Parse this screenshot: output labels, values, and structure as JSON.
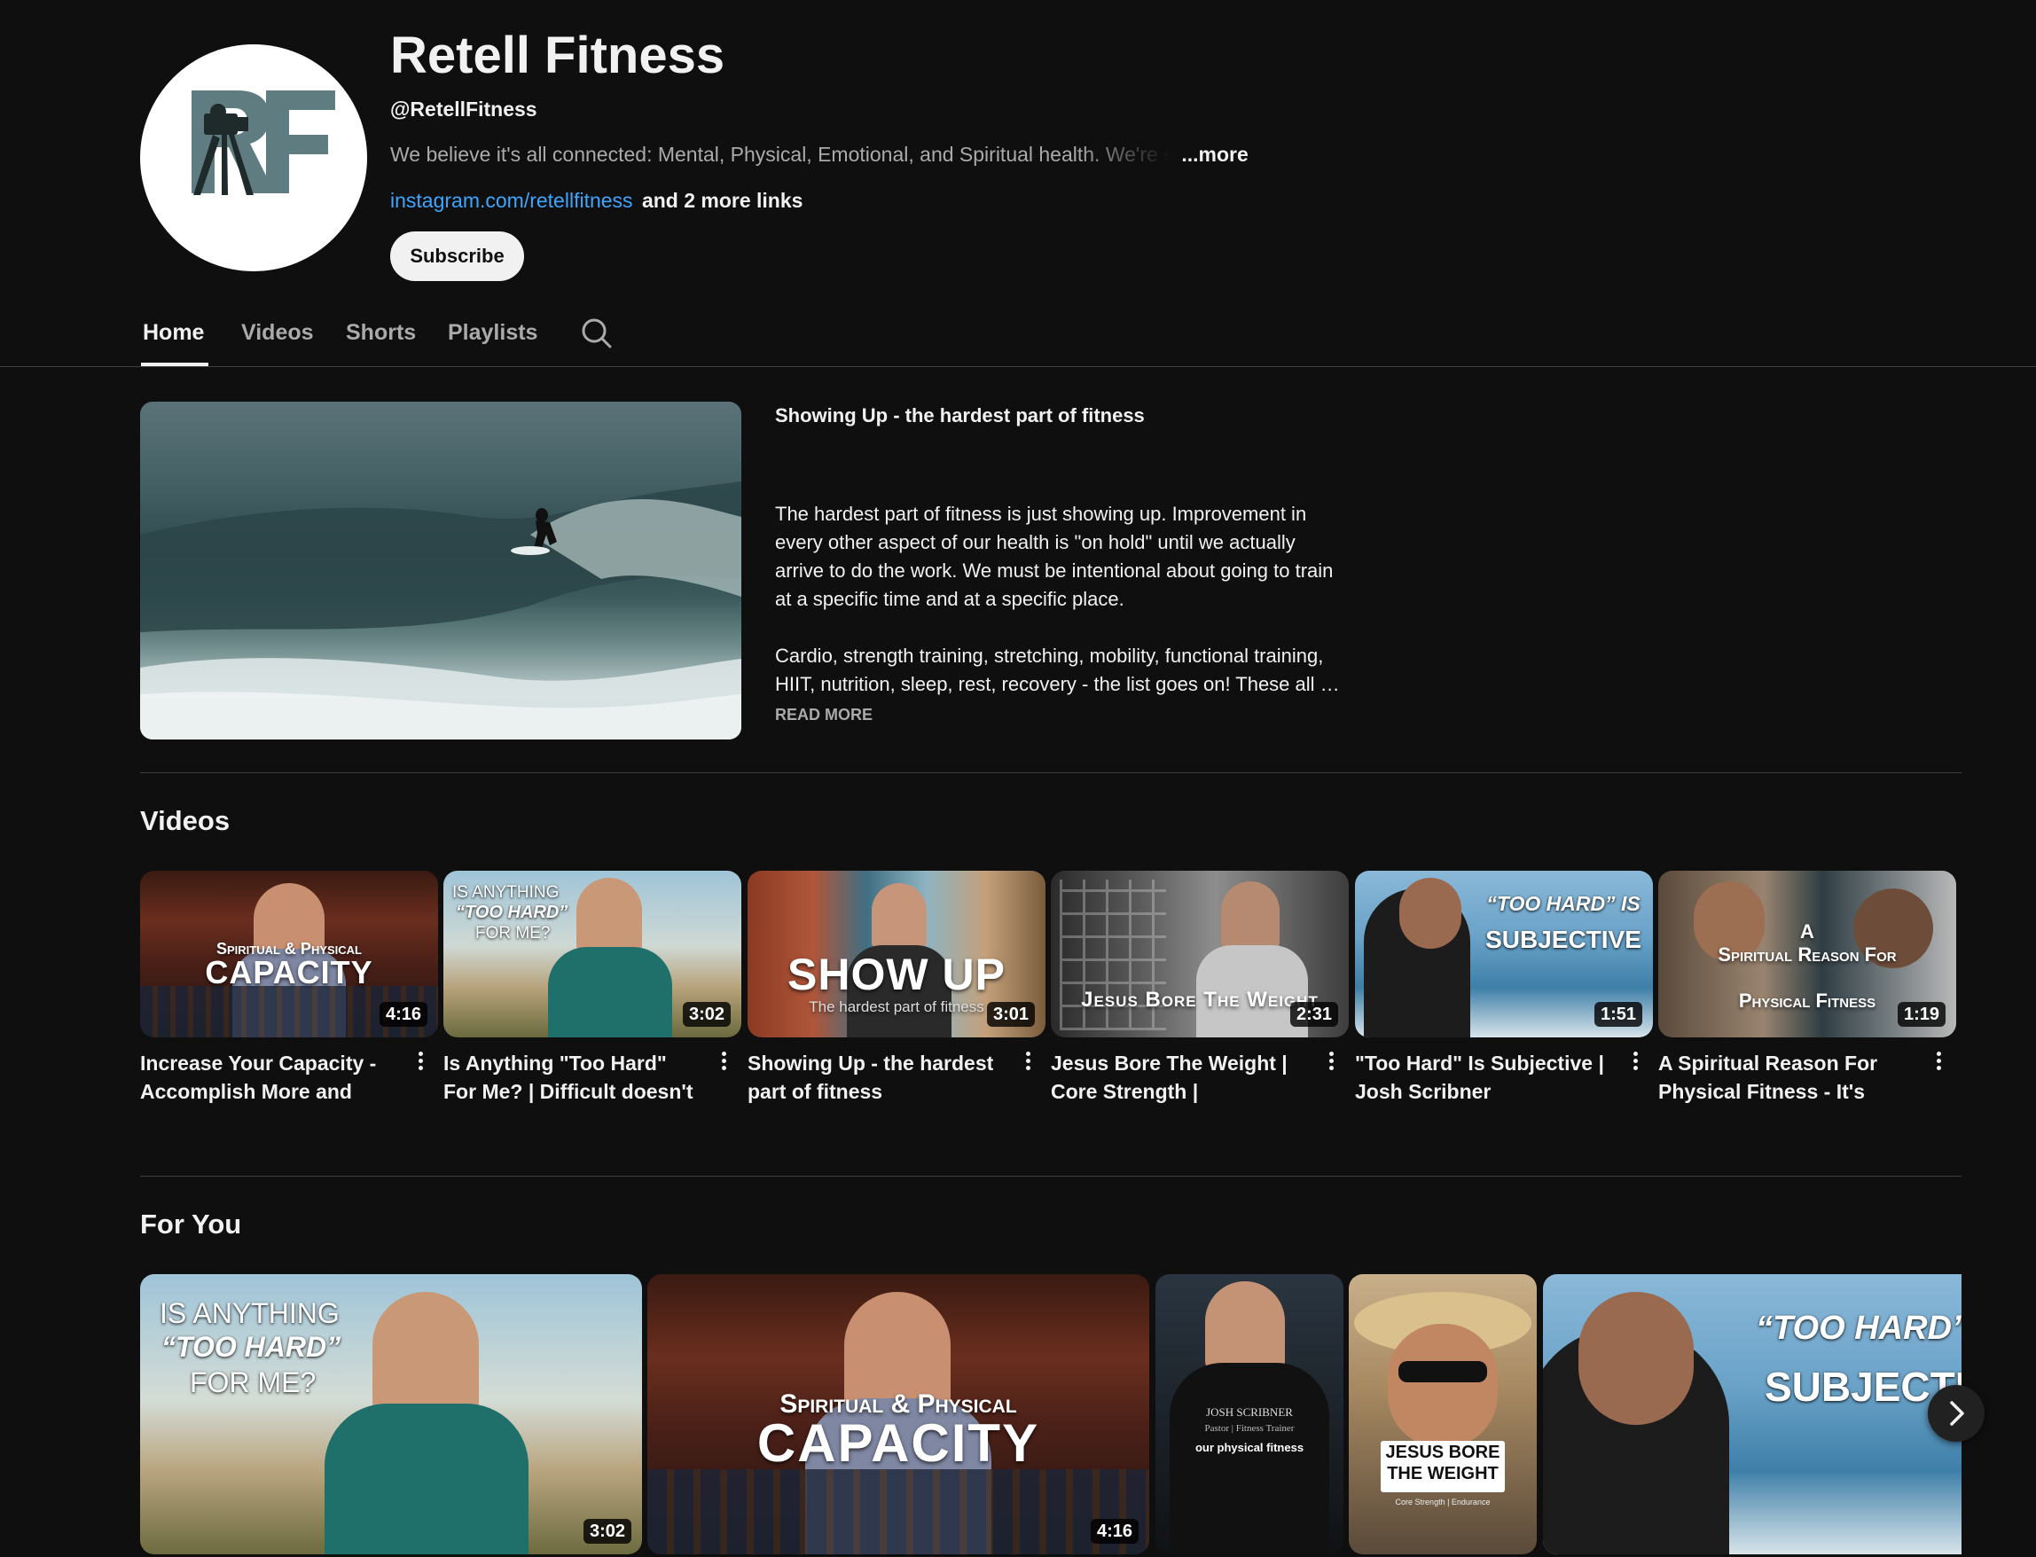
{
  "channel": {
    "name": "Retell Fitness",
    "handle": "@RetellFitness",
    "description": "We believe it's all connected: Mental, Physical, Emotional, and Spiritual health. We're excit",
    "more": "...more",
    "link": "instagram.com/retellfitness",
    "more_links": "and 2 more links",
    "subscribe": "Subscribe",
    "avatar_text": "RF"
  },
  "tabs": {
    "home": "Home",
    "videos": "Videos",
    "shorts": "Shorts",
    "playlists": "Playlists"
  },
  "featured": {
    "title": "Showing Up - the hardest part of fitness",
    "para1": "The hardest part of fitness is just showing up.  Improvement in every other aspect of our health is \"on hold\" until we actually arrive to do the work. We must be intentional about going to train at a specific time and at a specific place.",
    "para2": "Cardio, strength training, stretching, mobility, functional training, HIIT, nutrition, sleep, rest, recovery - the list goes on! These all …",
    "read_more": "READ MORE"
  },
  "videos_section": {
    "heading": "Videos",
    "items": [
      {
        "title": "Increase Your Capacity - Accomplish More and Fulfill…",
        "duration": "4:16",
        "overlay_top": "Spiritual & Physical",
        "overlay_main": "CAPACITY"
      },
      {
        "title": "Is Anything \"Too Hard\" For Me? | Difficult doesn't mean…",
        "duration": "3:02",
        "overlay_top": "IS ANYTHING",
        "overlay_mid": "“TOO HARD”",
        "overlay_bot": "FOR ME?"
      },
      {
        "title": "Showing Up - the hardest part of fitness",
        "duration": "3:01",
        "overlay_main": "SHOW UP",
        "overlay_sub": "The hardest part of fitness"
      },
      {
        "title": "Jesus Bore The Weight | Core Strength | Endurance |…",
        "duration": "2:31",
        "overlay_main": "Jesus Bore The Weight"
      },
      {
        "title": "\"Too Hard\" Is Subjective | Josh Scribner",
        "duration": "1:51",
        "overlay_top": "“TOO HARD” IS",
        "overlay_main": "SUBJECTIVE"
      },
      {
        "title": "A Spiritual Reason For Physical Fitness - It's All…",
        "duration": "1:19",
        "overlay_top": "A",
        "overlay_mid": "Spiritual Reason For",
        "overlay_bot": "Physical Fitness"
      }
    ]
  },
  "for_you": {
    "heading": "For You",
    "items": [
      {
        "duration": "3:02",
        "overlay_top": "IS ANYTHING",
        "overlay_mid": "“TOO HARD”",
        "overlay_bot": "FOR ME?"
      },
      {
        "duration": "4:16",
        "overlay_top": "Spiritual & Physical",
        "overlay_main": "CAPACITY"
      },
      {
        "name_line": "JOSH SCRIBNER",
        "role_line": "Pastor | Fitness Trainer",
        "caption": "our physical fitness"
      },
      {
        "sign_line1": "JESUS BORE",
        "sign_line2": "THE WEIGHT",
        "sign_sub": "Core Strength | Endurance"
      },
      {
        "overlay_top": "“TOO HARD”",
        "overlay_main": "SUBJECTIVE"
      }
    ]
  },
  "colors": {
    "background": "#0f0f0f",
    "link": "#3ea6ff",
    "text": "#f1f1f1",
    "muted": "#aaaaaa"
  }
}
